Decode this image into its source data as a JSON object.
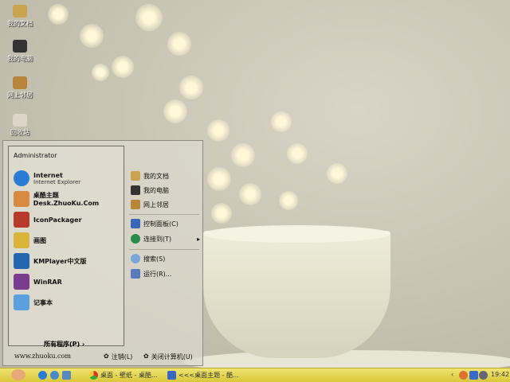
{
  "desktop": {
    "icons": [
      {
        "label": "我的文档",
        "color": "#c9a350"
      },
      {
        "label": "我的电脑",
        "color": "#333"
      },
      {
        "label": "网上邻居",
        "color": "#b8863b"
      },
      {
        "label": "回收站",
        "color": "#ddd5c8"
      }
    ]
  },
  "start_menu": {
    "user": "Administrator",
    "programs": [
      {
        "label": "Internet",
        "sub": "Internet Explorer",
        "color": "#2a7bd6"
      },
      {
        "label": "桌酷主题Desk.ZhuoKu.Com",
        "color": "#d88a40"
      },
      {
        "label": "IconPackager",
        "color": "#b83a2a"
      },
      {
        "label": "画图",
        "color": "#d9b33a"
      },
      {
        "label": "KMPlayer中文版",
        "color": "#2466b0"
      },
      {
        "label": "WinRAR",
        "color": "#7a3c8c"
      },
      {
        "label": "记事本",
        "color": "#5aa0dd"
      }
    ],
    "all_programs": "所有程序(P)",
    "places": [
      {
        "label": "我的文档",
        "color": "#c9a350"
      },
      {
        "label": "我的电脑",
        "color": "#333"
      },
      {
        "label": "网上邻居",
        "color": "#b8863b"
      },
      {
        "label": "控制面板(C)",
        "color": "#3a66b8"
      },
      {
        "label": "连接到(T)",
        "color": "#2a8a4a"
      },
      {
        "label": "搜索(S)",
        "color": "#7aa6d8"
      },
      {
        "label": "运行(R)...",
        "color": "#5a7ab8"
      }
    ],
    "website": "www.zhuoku.com",
    "logoff": "注销(L)",
    "shutdown": "关闭计算机(U)"
  },
  "taskbar": {
    "tasks": [
      "桌面 - 壁纸 - 桌酷...",
      "<<<桌面主题 - 酷..."
    ],
    "clock": "19:42"
  }
}
